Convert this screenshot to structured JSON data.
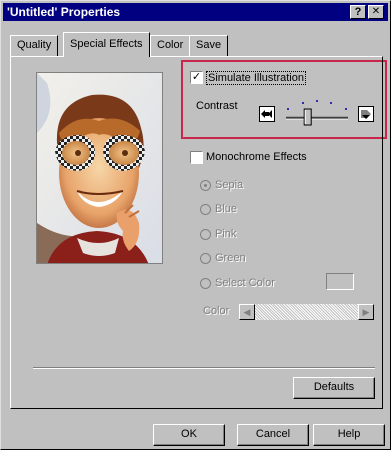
{
  "window": {
    "title": "'Untitled' Properties",
    "help_button": "?",
    "close_button": "✕"
  },
  "tabs": [
    {
      "label": "Quality",
      "active": false
    },
    {
      "label": "Special Effects",
      "active": true
    },
    {
      "label": "Color",
      "active": false
    },
    {
      "label": "Save",
      "active": false
    }
  ],
  "effects": {
    "simulate_illustration": {
      "label": "Simulate Illustration",
      "checked": true
    },
    "contrast": {
      "label": "Contrast",
      "level": 0.35
    },
    "monochrome": {
      "label": "Monochrome Effects",
      "checked": false
    },
    "options": [
      "Sepia",
      "Blue",
      "Pink",
      "Green",
      "Select Color"
    ],
    "selected_option": "Sepia",
    "color_label": "Color"
  },
  "buttons": {
    "defaults": "Defaults",
    "ok": "OK",
    "cancel": "Cancel",
    "help": "Help"
  },
  "colors": {
    "title_bar": "#000080",
    "highlight": "#c8264a"
  }
}
